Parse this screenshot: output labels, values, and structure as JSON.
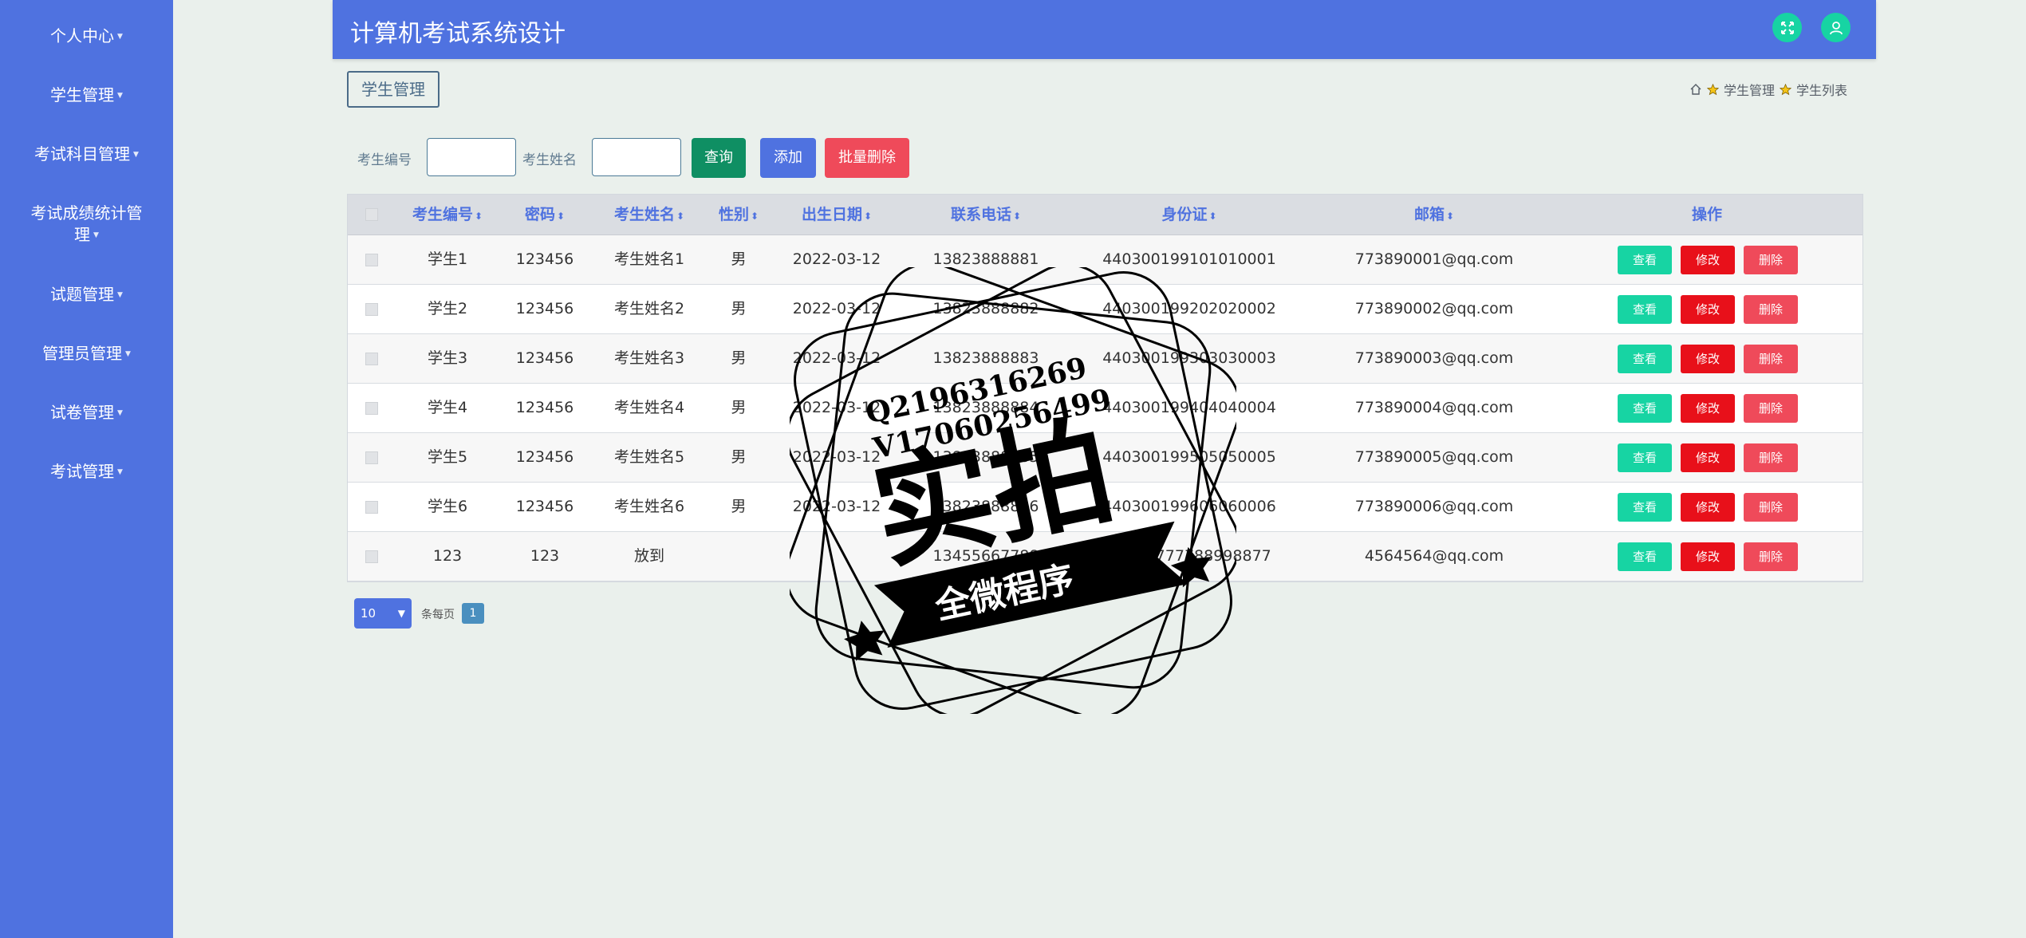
{
  "app_title": "计算机考试系统设计",
  "sidebar": {
    "items": [
      {
        "label": "个人中心"
      },
      {
        "label": "学生管理"
      },
      {
        "label": "考试科目管理"
      },
      {
        "label_line1": "考试成绩统计管",
        "label_line2": "理"
      },
      {
        "label": "试题管理"
      },
      {
        "label": "管理员管理"
      },
      {
        "label": "试卷管理"
      },
      {
        "label": "考试管理"
      }
    ]
  },
  "header_icons": [
    "expand-icon",
    "user-icon"
  ],
  "tab_label": "学生管理",
  "breadcrumb": {
    "home_icon": "home-icon",
    "separator_icon": "star-icon",
    "items": [
      "学生管理",
      "学生列表"
    ]
  },
  "search": {
    "student_no_label": "考生编号",
    "student_no_value": "",
    "student_name_label": "考生姓名",
    "student_name_value": "",
    "query_button": "查询",
    "add_button": "添加",
    "batch_delete_button": "批量删除"
  },
  "table": {
    "columns": [
      "考生编号",
      "密码",
      "考生姓名",
      "性别",
      "出生日期",
      "联系电话",
      "身份证",
      "邮箱",
      "操作"
    ],
    "sort_icon": "sort-icon",
    "rows": [
      {
        "no": "学生1",
        "password": "123456",
        "name": "考生姓名1",
        "gender": "男",
        "birth": "2022-03-12",
        "phone": "13823888881",
        "id_card": "440300199101010001",
        "email": "773890001@qq.com"
      },
      {
        "no": "学生2",
        "password": "123456",
        "name": "考生姓名2",
        "gender": "男",
        "birth": "2022-03-12",
        "phone": "13823888882",
        "id_card": "440300199202020002",
        "email": "773890002@qq.com"
      },
      {
        "no": "学生3",
        "password": "123456",
        "name": "考生姓名3",
        "gender": "男",
        "birth": "2022-03-12",
        "phone": "13823888883",
        "id_card": "440300199303030003",
        "email": "773890003@qq.com"
      },
      {
        "no": "学生4",
        "password": "123456",
        "name": "考生姓名4",
        "gender": "男",
        "birth": "2022-03-12",
        "phone": "13823888884",
        "id_card": "440300199404040004",
        "email": "773890004@qq.com"
      },
      {
        "no": "学生5",
        "password": "123456",
        "name": "考生姓名5",
        "gender": "男",
        "birth": "2022-03-12",
        "phone": "13823888885",
        "id_card": "440300199505050005",
        "email": "773890005@qq.com"
      },
      {
        "no": "学生6",
        "password": "123456",
        "name": "考生姓名6",
        "gender": "男",
        "birth": "2022-03-12",
        "phone": "13823888886",
        "id_card": "440300199606060006",
        "email": "773890006@qq.com"
      },
      {
        "no": "123",
        "password": "123",
        "name": "放到",
        "gender": "",
        "birth": "",
        "phone": "13455667788",
        "id_card": "44152777788998877",
        "email": "4564564@qq.com"
      }
    ],
    "actions": {
      "view": "查看",
      "edit": "修改",
      "delete": "删除"
    }
  },
  "pagination": {
    "page_size": "10",
    "per_page_label": "条每页",
    "current_page": "1"
  },
  "watermark": {
    "line1": "Q2196316269",
    "line2": "V17060256499",
    "big": "实拍",
    "banner": "全微程序"
  },
  "colors": {
    "primary": "#4f72e0",
    "teal": "#17d4a3",
    "red": "#e8101a",
    "pink_red": "#ef4a5a",
    "dark_green": "#0f8f63",
    "background": "#eaf0ec"
  }
}
